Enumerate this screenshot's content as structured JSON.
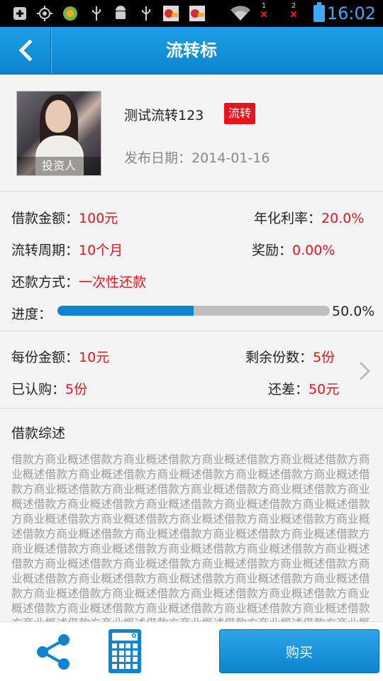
{
  "status_bar": {
    "time": "16:02",
    "icons": [
      "add-box-icon",
      "gps-icon",
      "app-icon",
      "usb-icon",
      "android-debug-icon",
      "usb-icon",
      "app-notify-icon",
      "app-notify-icon",
      "wifi-icon",
      "signal-1-icon",
      "signal-2-icon",
      "battery-icon"
    ],
    "sim1": "1",
    "sim2": "2",
    "accent": "#3fa9f5"
  },
  "header": {
    "title": "流转标",
    "back_icon": "chevron-left-icon",
    "color": "#0c84cf"
  },
  "product": {
    "avatar_label": "投资人",
    "name": "测试流转123",
    "badge": "流转",
    "publish_date": "发布日期：2014-01-16"
  },
  "info": {
    "loan_amount_label": "借款金额：",
    "loan_amount_value": "100元",
    "annual_rate_label": "年化利率：",
    "annual_rate_value": "20.0%",
    "period_label": "流转周期：",
    "period_value": "10个月",
    "reward_label": "奖励：",
    "reward_value": "0.00%",
    "repay_label": "还款方式：",
    "repay_value": "一次性还款",
    "progress_label": "进度：",
    "progress_text": "50.0%",
    "progress_fraction": 0.5
  },
  "shares": {
    "per_share_label": "每份金额：",
    "per_share_value": "10元",
    "remaining_label": "剩余份数：",
    "remaining_value": "5份",
    "subscribed_label": "已认购：",
    "subscribed_value": "5份",
    "shortfall_label": "还差：",
    "shortfall_value": "50元",
    "more_icon": "chevron-right-icon"
  },
  "summary": {
    "title": "借款综述",
    "body": "借款方商业概述借款方商业概述借款方商业概述借款方商业概述借款方商业概述借款方商业概述借款方商业概述借款方商业概述借款方商业概述借款方商业概述借款方商业概述借款方商业概述借款方商业概述借款方商业概述借款方商业概述借款方商业概述借款方商业概述借款方商业概述借款方商业概述借款方商业概述借款方商业概述借款方商业概述借款方商业概述借款方商业概述借款方商业概述借款方商业概述借款方商业概述借款方商业概述借款方商业概述借款方商业概述借款方商业概述借款方商业概述借款方商业概述借款方商业概述借款方商业概述借款方商业概述借款方商业概述借款方商业概述借款方商业概述借款方商业概述借款方商业概述借款方商业概述借款方商业概述借款方商业概述借款方商业概述借款方商业概述借款方商业概述借款方商业概述借款方商业概述借款方商业概述借款方商业概述借款方商业概述借款方商业概述借款方商业概述借款方商业概述借款方商业概述借款方商业概述借款方商业概述借款方商业概述借款方商业概述"
  },
  "bottom_bar": {
    "share_icon": "share-icon",
    "calculator_icon": "calculator-icon",
    "calculator_digit": "0",
    "buy_label": "购买"
  },
  "colors": {
    "accent_blue": "#0c84cf",
    "highlight_red": "#e8131b"
  }
}
